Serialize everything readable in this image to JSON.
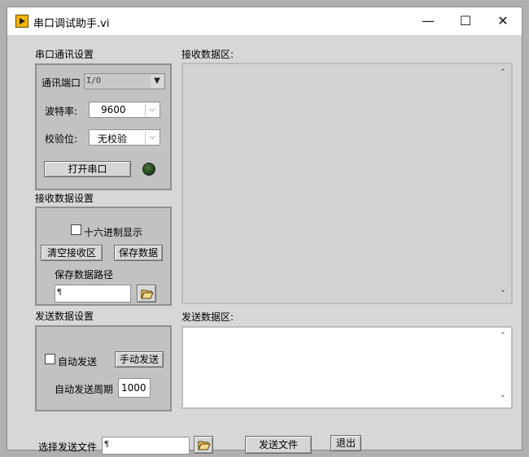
{
  "window": {
    "title": "串口调试助手.vi",
    "controls": {
      "minimize": "—",
      "maximize": "☐",
      "close": "✕"
    }
  },
  "serial_settings": {
    "heading": "串口通讯设置",
    "port_label": "通讯端口",
    "port_value": "",
    "baud_label": "波特率:",
    "baud_value": "9600",
    "parity_label": "校验位:",
    "parity_value": "无校验",
    "open_button": "打开串口"
  },
  "receive_settings": {
    "heading": "接收数据设置",
    "hex_checkbox_label": "十六进制显示",
    "hex_checked": false,
    "clear_button": "清空接收区",
    "save_button": "保存数据",
    "save_path_label": "保存数据路径",
    "save_path_value": ""
  },
  "send_settings": {
    "heading": "发送数据设置",
    "auto_send_label": "自动发送",
    "auto_send_checked": false,
    "manual_send_button": "手动发送",
    "period_label": "自动发送周期",
    "period_value": "1000"
  },
  "receive_area": {
    "label": "接收数据区:",
    "content": ""
  },
  "send_area": {
    "label": "发送数据区:",
    "content": ""
  },
  "bottom": {
    "file_label": "选择发送文件",
    "file_value": "",
    "send_file_button": "发送文件",
    "exit_button": "退出"
  },
  "colors": {
    "panel_bg": "#d7d7d7",
    "section_bg": "#c2c2c2",
    "receive_area_bg": "#d2d2d2",
    "send_area_bg": "#ffffff",
    "led_off": "#2c5a26",
    "app_icon": "#f3b400"
  }
}
